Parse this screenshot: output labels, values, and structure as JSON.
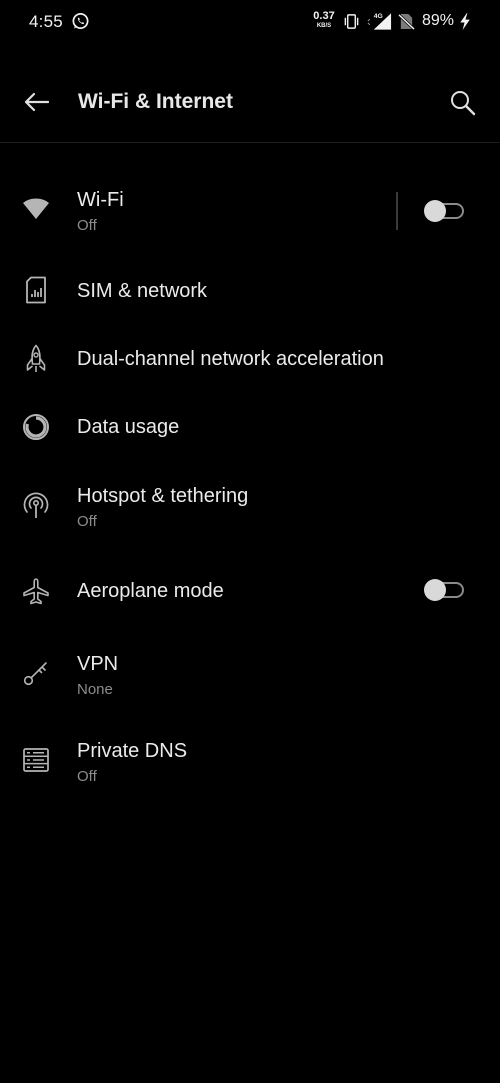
{
  "status_bar": {
    "time": "4:55",
    "net_speed_value": "0.37",
    "net_speed_unit": "KB/S",
    "network_type": "4G",
    "battery": "89%",
    "icons": [
      "whatsapp-icon",
      "vibrate-icon",
      "signal-icon",
      "no-sim-icon",
      "charging-icon"
    ]
  },
  "app_bar": {
    "title": "Wi-Fi & Internet",
    "back_icon": "arrow-left-icon",
    "search_icon": "search-icon"
  },
  "items": [
    {
      "title": "Wi-Fi",
      "subtitle": "Off",
      "icon": "wifi-icon",
      "toggle": "off"
    },
    {
      "title": "SIM & network",
      "icon": "sim-card-icon"
    },
    {
      "title": "Dual-channel network acceleration",
      "icon": "rocket-icon"
    },
    {
      "title": "Data usage",
      "icon": "data-usage-icon"
    },
    {
      "title": "Hotspot & tethering",
      "subtitle": "Off",
      "icon": "hotspot-icon"
    },
    {
      "title": "Aeroplane mode",
      "icon": "airplane-icon",
      "toggle": "off"
    },
    {
      "title": "VPN",
      "subtitle": "None",
      "icon": "key-icon"
    },
    {
      "title": "Private DNS",
      "subtitle": "Off",
      "icon": "dns-icon"
    }
  ],
  "colors": {
    "background": "#000000",
    "text_primary": "#ebebeb",
    "text_secondary": "#8c8c8c",
    "icon": "#b5b5b5"
  }
}
